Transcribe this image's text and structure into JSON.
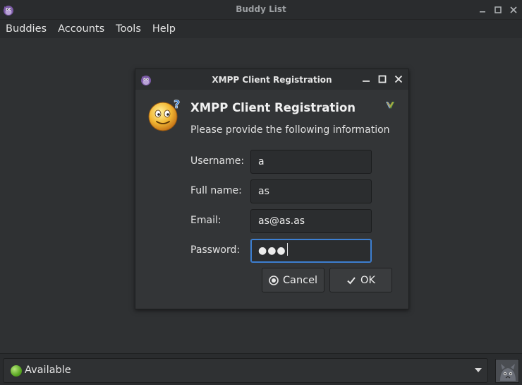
{
  "window": {
    "title": "Buddy List"
  },
  "menubar": {
    "items": [
      "Buddies",
      "Accounts",
      "Tools",
      "Help"
    ]
  },
  "dialog": {
    "title": "XMPP Client Registration",
    "heading": "XMPP Client Registration",
    "subheading": "Please provide the following information",
    "fields": {
      "username": {
        "label": "Username:",
        "value": "a"
      },
      "fullname": {
        "label": "Full name:",
        "value": "as"
      },
      "email": {
        "label": "Email:",
        "value": "as@as.as"
      },
      "password": {
        "label": "Password:",
        "masked": "●●●"
      }
    },
    "buttons": {
      "cancel": "Cancel",
      "ok": "OK"
    }
  },
  "statusbar": {
    "status": "Available",
    "status_color": "#5aa823"
  },
  "icons": {
    "app": "pidgin-icon",
    "dialog_app": "pidgin-icon",
    "dialog_heading": "smiley-question-icon",
    "dialog_corner": "pidgin-small-icon",
    "window_minimize": "minimize-icon",
    "window_maximize": "maximize-icon",
    "window_close": "close-icon",
    "cancel": "cancel-icon",
    "ok": "checkmark-icon",
    "status": "available-dot-icon",
    "avatar": "buddy-icon"
  },
  "colors": {
    "background": "#2f3133",
    "focus_border": "#3d7fd1"
  }
}
